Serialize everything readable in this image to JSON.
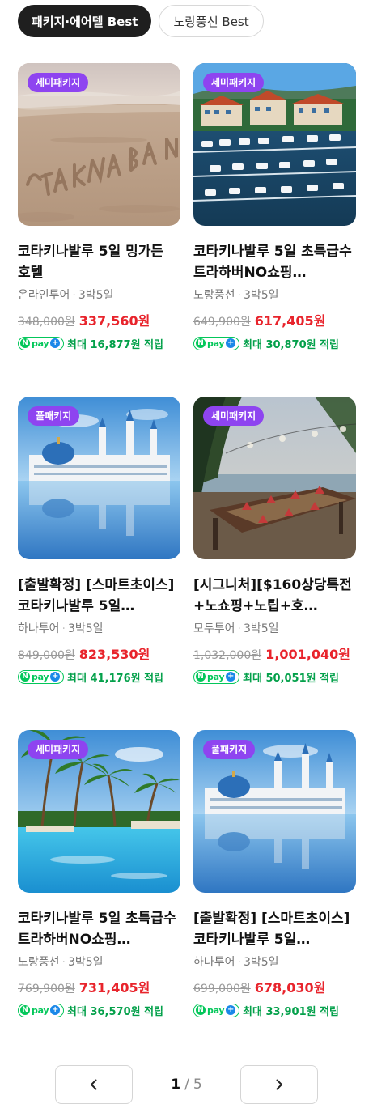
{
  "tabs": [
    {
      "label": "패키지·에어텔 Best"
    },
    {
      "label": "노랑풍선 Best"
    }
  ],
  "products": [
    {
      "badge": "세미패키지",
      "title": "코타키나발루 5일 밍가든 호텔",
      "agency": "온라인투어",
      "duration": "3박5일",
      "original_price": "348,000원",
      "sale_price": "337,560원",
      "reward": "최대 16,877원 적립",
      "image": "sand-beach"
    },
    {
      "badge": "세미패키지",
      "title": "코타키나발루 5일 초특급수트라하버NO쇼핑…",
      "agency": "노랑풍선",
      "duration": "3박5일",
      "original_price": "649,900원",
      "sale_price": "617,405원",
      "reward": "최대 30,870원 적립",
      "image": "marina-resort"
    },
    {
      "badge": "풀패키지",
      "title": "[출발확정] [스마트초이스] 코타키나발루 5일…",
      "agency": "하나투어",
      "duration": "3박5일",
      "original_price": "849,000원",
      "sale_price": "823,530원",
      "reward": "최대 41,176원 적립",
      "image": "floating-mosque"
    },
    {
      "badge": "세미패키지",
      "title": "[시그니처][$160상당특전+노쇼핑+노팁+호…",
      "agency": "모두투어",
      "duration": "3박5일",
      "original_price": "1,032,000원",
      "sale_price": "1,001,040원",
      "reward": "최대 50,051원 적립",
      "image": "seaside-restaurant"
    },
    {
      "badge": "세미패키지",
      "title": "코타키나발루 5일 초특급수트라하버NO쇼핑…",
      "agency": "노랑풍선",
      "duration": "3박5일",
      "original_price": "769,900원",
      "sale_price": "731,405원",
      "reward": "최대 36,570원 적립",
      "image": "resort-pool"
    },
    {
      "badge": "풀패키지",
      "title": "[출발확정] [스마트초이스] 코타키나발루 5일…",
      "agency": "하나투어",
      "duration": "3박5일",
      "original_price": "699,000원",
      "sale_price": "678,030원",
      "reward": "최대 33,901원 적립",
      "image": "floating-mosque"
    }
  ],
  "npay": {
    "n": "N",
    "word": "pay",
    "plus": "+"
  },
  "pagination": {
    "current": "1",
    "separator": "/",
    "total": "5",
    "prev_icon": "chevron-left-icon",
    "next_icon": "chevron-right-icon"
  },
  "colors": {
    "badge": "#8e44f0",
    "sale": "#e8242c",
    "npay_green": "#03c75a",
    "tab_active": "#1f1f1f"
  }
}
